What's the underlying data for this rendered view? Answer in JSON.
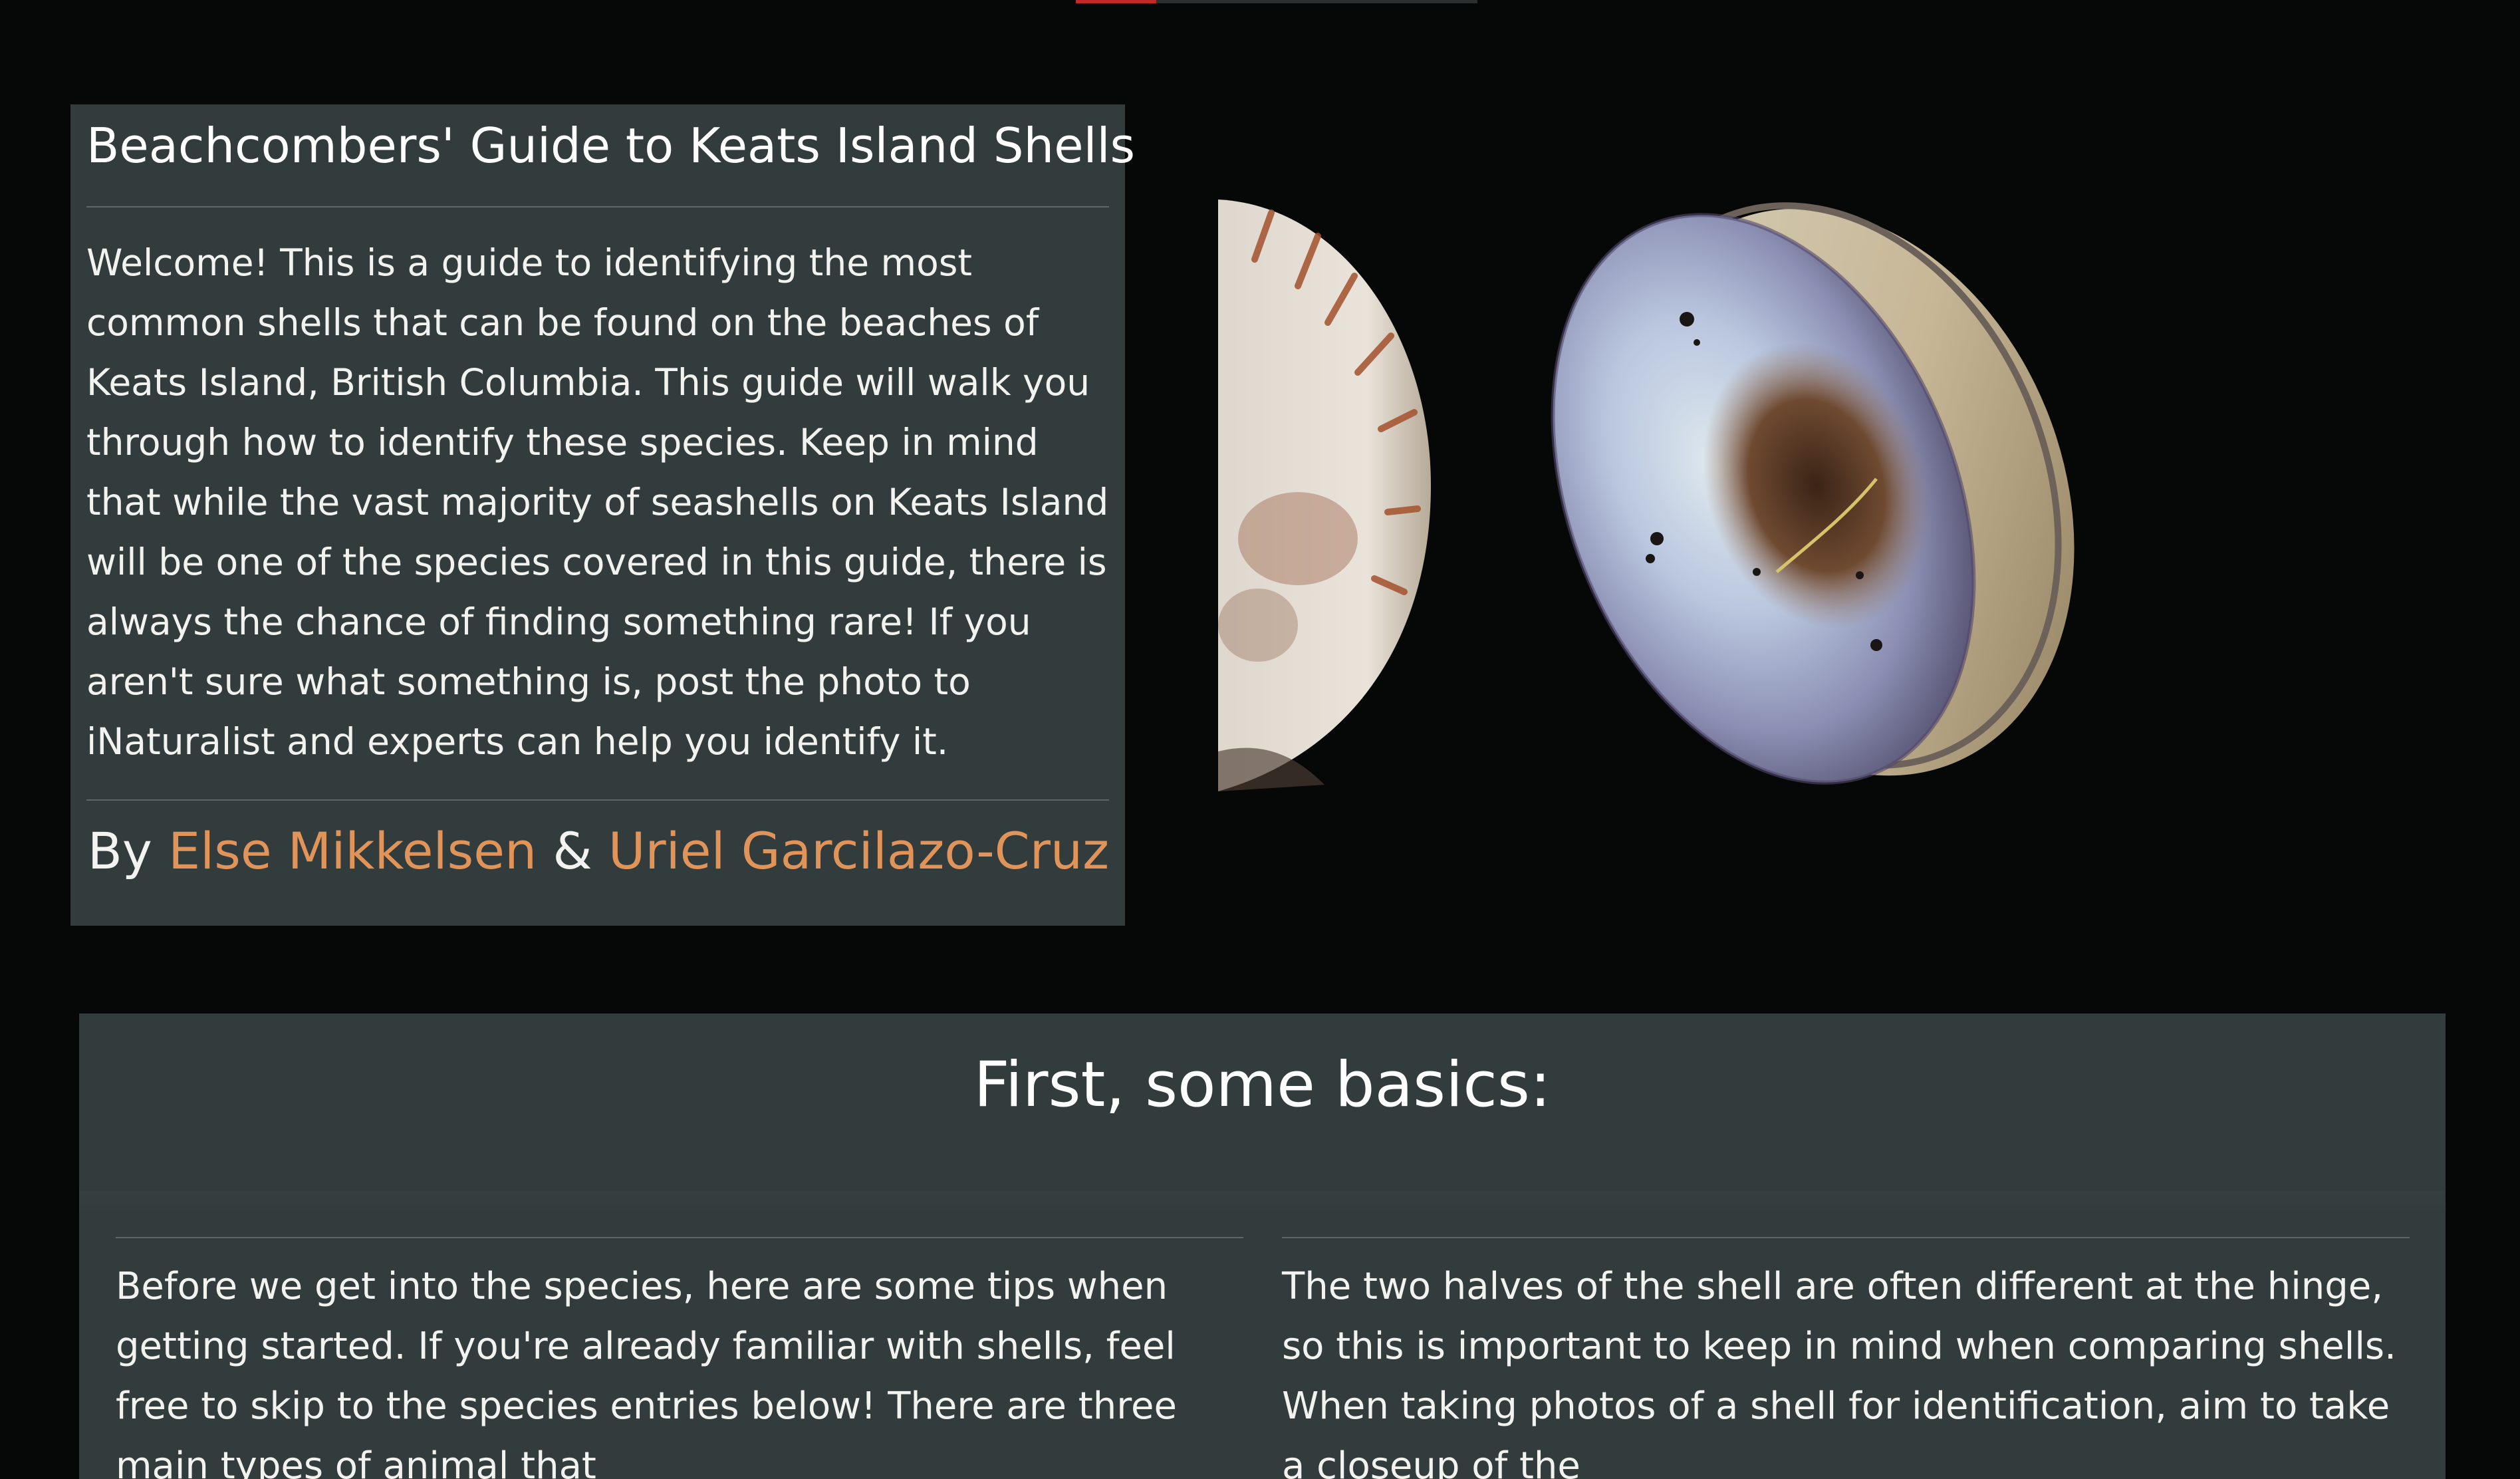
{
  "progress": {
    "value": 0.2,
    "fill_color": "#c22a2a"
  },
  "intro": {
    "title": "Beachcombers' Guide to Keats Island Shells",
    "body": "Welcome! This is a guide to identifying the most common shells that can be found on the beaches of Keats Island, British Columbia. This guide will walk you through how to identify these species. Keep in mind that while the vast majority of seashells on Keats Island will be one of the species covered in this guide, there is always the chance of finding something rare! If you aren't sure what something is, post the photo to iNaturalist and experts can help you identify it.",
    "byline_prefix": "By",
    "author_1": "Else Mikkelsen",
    "separator": "&",
    "author_2": "Uriel Garcilazo-Cruz",
    "link_color": "#e0945a"
  },
  "viewer": {
    "icon": "shell-3d-model"
  },
  "basics": {
    "title": "First, some basics:",
    "left_text": "Before we get into the species, here are some tips when getting started. If you're already familiar with shells, feel free to skip to the species entries below! There are three main types of animal that",
    "right_text": "The two halves of the shell are often different at the hinge, so this is important to keep in mind when comparing shells. When taking photos of a shell for identification, aim to take a closeup of the"
  },
  "colors": {
    "page_background": "#060808",
    "panel_background": "#333c3c"
  }
}
